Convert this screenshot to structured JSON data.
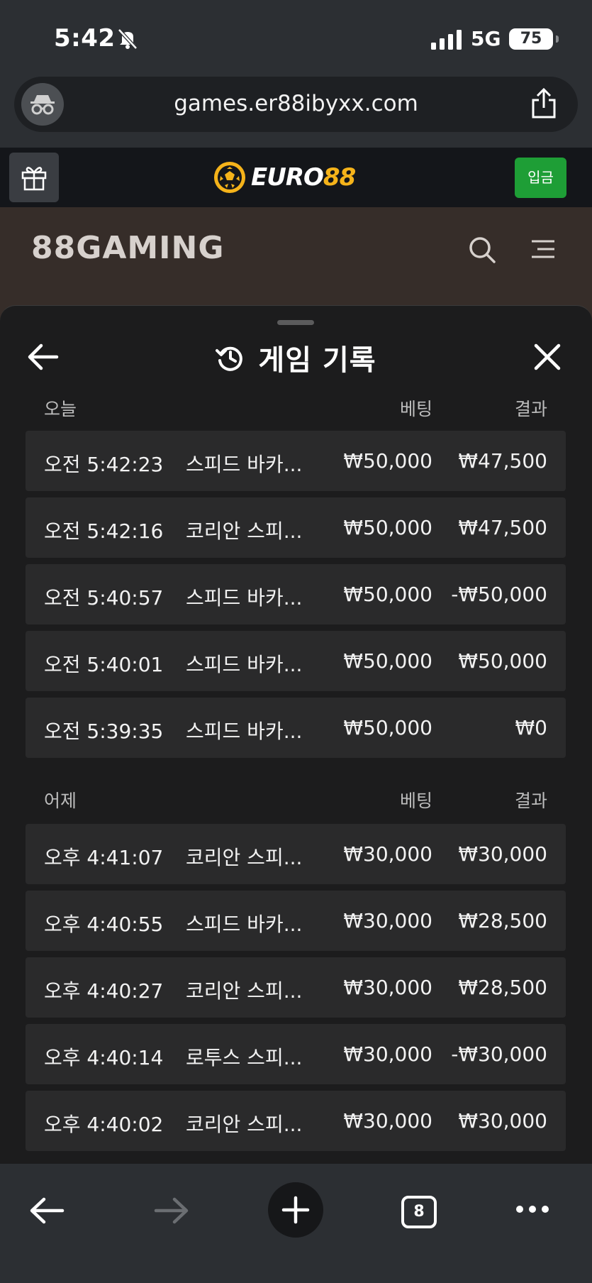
{
  "status_bar": {
    "time": "5:42",
    "network": "5G",
    "battery": "75"
  },
  "browser": {
    "url": "games.er88ibyxx.com",
    "open_tabs": "8"
  },
  "site": {
    "logo_brand": "EURO",
    "logo_number": "88",
    "deposit_label": "입금",
    "game_logo": "88GAMING"
  },
  "modal": {
    "title": "게임 기록",
    "sections": [
      {
        "label": "오늘",
        "bet_header": "베팅",
        "result_header": "결과",
        "rows": [
          {
            "time": "오전 5:42:23",
            "game": "스피드 바카...",
            "bet": "₩50,000",
            "result": "₩47,500"
          },
          {
            "time": "오전 5:42:16",
            "game": "코리안 스피...",
            "bet": "₩50,000",
            "result": "₩47,500"
          },
          {
            "time": "오전 5:40:57",
            "game": "스피드 바카...",
            "bet": "₩50,000",
            "result": "-₩50,000"
          },
          {
            "time": "오전 5:40:01",
            "game": "스피드 바카...",
            "bet": "₩50,000",
            "result": "₩50,000"
          },
          {
            "time": "오전 5:39:35",
            "game": "스피드 바카...",
            "bet": "₩50,000",
            "result": "₩0"
          }
        ]
      },
      {
        "label": "어제",
        "bet_header": "베팅",
        "result_header": "결과",
        "rows": [
          {
            "time": "오후 4:41:07",
            "game": "코리안 스피...",
            "bet": "₩30,000",
            "result": "₩30,000"
          },
          {
            "time": "오후 4:40:55",
            "game": "스피드 바카...",
            "bet": "₩30,000",
            "result": "₩28,500"
          },
          {
            "time": "오후 4:40:27",
            "game": "코리안 스피...",
            "bet": "₩30,000",
            "result": "₩28,500"
          },
          {
            "time": "오후 4:40:14",
            "game": "로투스 스피...",
            "bet": "₩30,000",
            "result": "-₩30,000"
          },
          {
            "time": "오후 4:40:02",
            "game": "코리안 스피...",
            "bet": "₩30,000",
            "result": "₩30,000"
          }
        ]
      }
    ]
  },
  "colors": {
    "accent_gold": "#f5b31a",
    "deposit_green": "#1e9e36"
  }
}
